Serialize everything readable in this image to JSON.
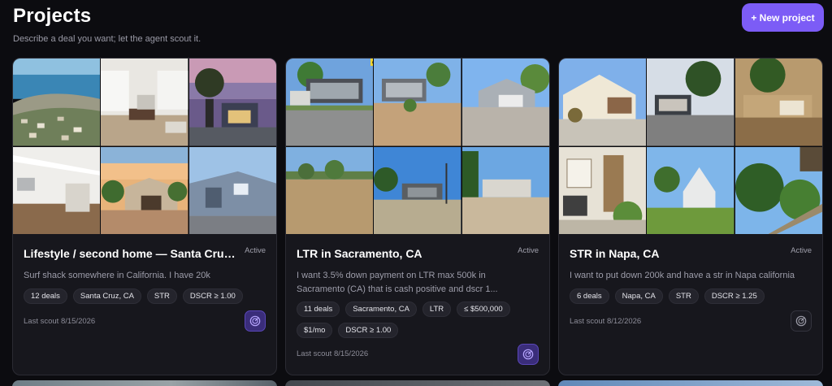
{
  "header": {
    "title": "Projects",
    "subtitle": "Describe a deal you want; let the agent scout it.",
    "new_project_label": "+ New project"
  },
  "projects": [
    {
      "title": "Lifestyle / second home — Santa Cruz, CA",
      "status": "Active",
      "description": "Surf shack somewhere in California. I have 20k",
      "chips": [
        "12 deals",
        "Santa Cruz, CA",
        "STR",
        "DSCR ≥ 1.00"
      ],
      "last_scout": "Last scout 8/15/2026",
      "scout_icon": "radar-icon",
      "scout_active": true
    },
    {
      "title": "LTR in Sacramento, CA",
      "status": "Active",
      "description": "I want 3.5% down payment on LTR max 500k in Sacramento (CA) that is cash positive and dscr 1...",
      "chips": [
        "11 deals",
        "Sacramento, CA",
        "LTR",
        "≤ $500,000",
        "$1/mo",
        "DSCR ≥ 1.00"
      ],
      "last_scout": "Last scout 8/15/2026",
      "scout_icon": "radar-icon",
      "scout_active": true,
      "photo_ribbon": "on"
    },
    {
      "title": "STR in Napa, CA",
      "status": "Active",
      "description": "I want to put down 200k and have a str in Napa california",
      "chips": [
        "6 deals",
        "Napa, CA",
        "STR",
        "DSCR ≥ 1.25"
      ],
      "last_scout": "Last scout 8/12/2026",
      "scout_icon": "radar-icon",
      "scout_active": false
    }
  ],
  "colors": {
    "background": "#0c0c10",
    "card": "#17171d",
    "accent": "#7c5cf6",
    "chip": "#24242c"
  }
}
